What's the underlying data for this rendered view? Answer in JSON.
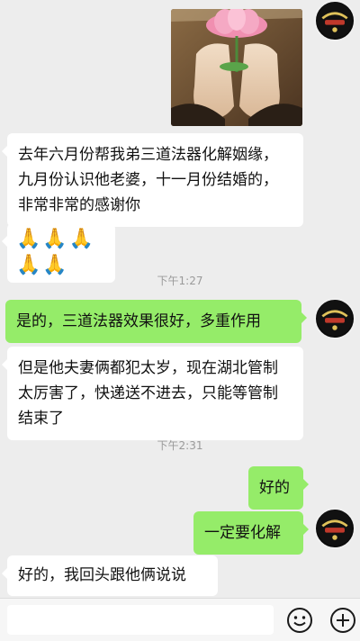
{
  "messages": [
    {
      "type": "image",
      "sender": "self",
      "subject": "lotus-hands-image"
    },
    {
      "type": "text",
      "sender": "other",
      "text": "去年六月份帮我弟三道法器化解姻缘，九月份认识他老婆，十一月份结婚的，非常非常的感谢你"
    },
    {
      "type": "emoji",
      "sender": "other",
      "text": "🙏🙏🙏🙏🙏"
    },
    {
      "type": "time",
      "text": "下午1:27"
    },
    {
      "type": "text",
      "sender": "self",
      "text": "是的，三道法器效果很好，多重作用"
    },
    {
      "type": "text",
      "sender": "other",
      "text": "但是他夫妻俩都犯太岁，现在湖北管制太厉害了，快递送不进去，只能等管制结束了"
    },
    {
      "type": "time",
      "text": "下午2:31"
    },
    {
      "type": "text",
      "sender": "self",
      "text": "好的"
    },
    {
      "type": "text",
      "sender": "self",
      "text": "一定要化解"
    },
    {
      "type": "text",
      "sender": "other",
      "text": "好的，我回头跟他俩说说"
    }
  ],
  "colors": {
    "background": "#ededed",
    "incoming_bubble": "#ffffff",
    "outgoing_bubble": "#95ec69",
    "timestamp": "#9a9a9a"
  },
  "input_bar": {
    "icons": [
      "emoji-icon",
      "plus-icon"
    ]
  }
}
